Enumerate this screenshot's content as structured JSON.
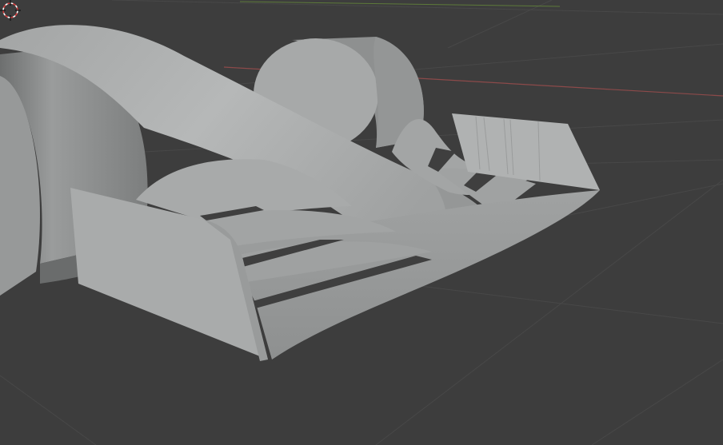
{
  "viewport": {
    "background": "#3d3d3d",
    "grid_color": "#4a4a4a",
    "x_axis_color": "#8c4a4a",
    "y_axis_color": "#5d7a3a",
    "model_color": "#a9abab",
    "model_shadow": "#7c7e7e"
  },
  "icons": {
    "cursor": "3d-cursor-icon"
  }
}
